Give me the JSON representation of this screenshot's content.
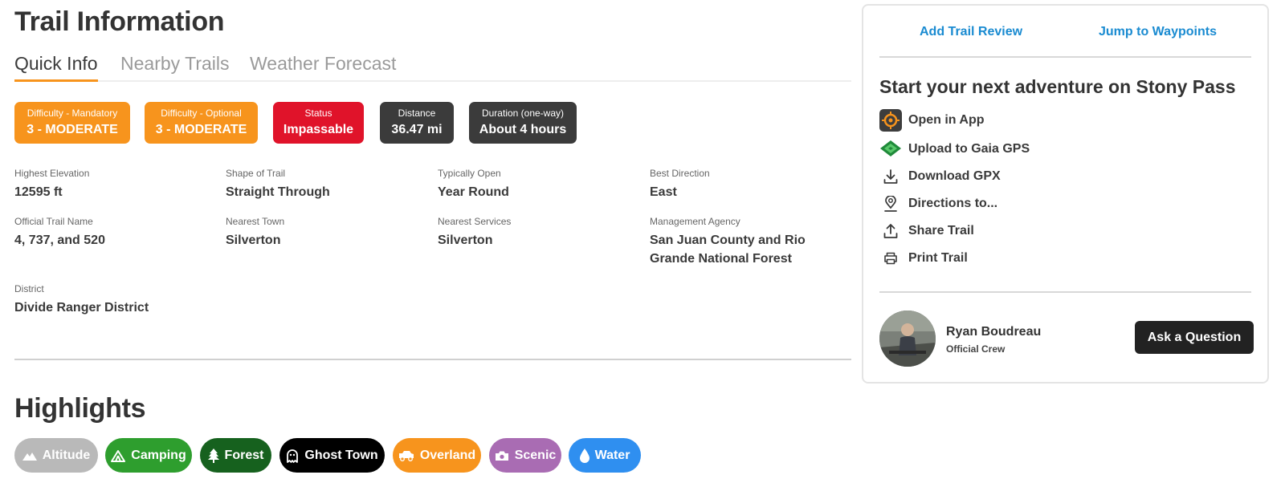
{
  "page": {
    "title": "Trail Information"
  },
  "tabs": [
    {
      "label": "Quick Info",
      "active": true
    },
    {
      "label": "Nearby Trails",
      "active": false
    },
    {
      "label": "Weather Forecast",
      "active": false
    }
  ],
  "badges": [
    {
      "label": "Difficulty - Mandatory",
      "value": "3 - MODERATE",
      "color": "#f7941d"
    },
    {
      "label": "Difficulty - Optional",
      "value": "3 - MODERATE",
      "color": "#f7941d"
    },
    {
      "label": "Status",
      "value": "Impassable",
      "color": "#e0132a"
    },
    {
      "label": "Distance",
      "value": "36.47 mi",
      "color": "#3b3b3b"
    },
    {
      "label": "Duration (one-way)",
      "value": "About 4 hours",
      "color": "#3b3b3b"
    }
  ],
  "info": {
    "highest_elevation": {
      "label": "Highest Elevation",
      "value": "12595 ft"
    },
    "shape": {
      "label": "Shape of Trail",
      "value": "Straight Through"
    },
    "typically_open": {
      "label": "Typically Open",
      "value": "Year Round"
    },
    "best_direction": {
      "label": "Best Direction",
      "value": "East"
    },
    "official_name": {
      "label": "Official Trail Name",
      "value": "4, 737, and 520"
    },
    "nearest_town": {
      "label": "Nearest Town",
      "value": "Silverton"
    },
    "nearest_services": {
      "label": "Nearest Services",
      "value": "Silverton"
    },
    "management_agency": {
      "label": "Management Agency",
      "value": "San Juan County and Rio Grande National Forest"
    },
    "district": {
      "label": "District",
      "value": "Divide Ranger District"
    }
  },
  "highlights": {
    "title": "Highlights",
    "chips": [
      {
        "label": "Altitude",
        "icon": "mountain-icon",
        "color": "#b9b9b9"
      },
      {
        "label": "Camping",
        "icon": "tent-icon",
        "color": "#2e9e2e"
      },
      {
        "label": "Forest",
        "icon": "tree-icon",
        "color": "#16611e"
      },
      {
        "label": "Ghost Town",
        "icon": "ghost-icon",
        "color": "#000000"
      },
      {
        "label": "Overland",
        "icon": "truck-icon",
        "color": "#f7941d"
      },
      {
        "label": "Scenic",
        "icon": "camera-icon",
        "color": "#a96cb3"
      },
      {
        "label": "Water",
        "icon": "water-drop-icon",
        "color": "#2f8ff0"
      }
    ]
  },
  "panel": {
    "add_review": "Add Trail Review",
    "jump_waypoints": "Jump to Waypoints",
    "heading": "Start your next adventure on Stony Pass",
    "actions": [
      {
        "label": "Open in App",
        "icon": "app-icon"
      },
      {
        "label": "Upload to Gaia GPS",
        "icon": "gaia-gps-icon"
      },
      {
        "label": "Download GPX",
        "icon": "download-icon"
      },
      {
        "label": "Directions to...",
        "icon": "map-pin-icon"
      },
      {
        "label": "Share Trail",
        "icon": "share-icon"
      },
      {
        "label": "Print Trail",
        "icon": "printer-icon"
      }
    ],
    "crew": {
      "name": "Ryan Boudreau",
      "role": "Official Crew"
    },
    "ask_button": "Ask a Question"
  }
}
